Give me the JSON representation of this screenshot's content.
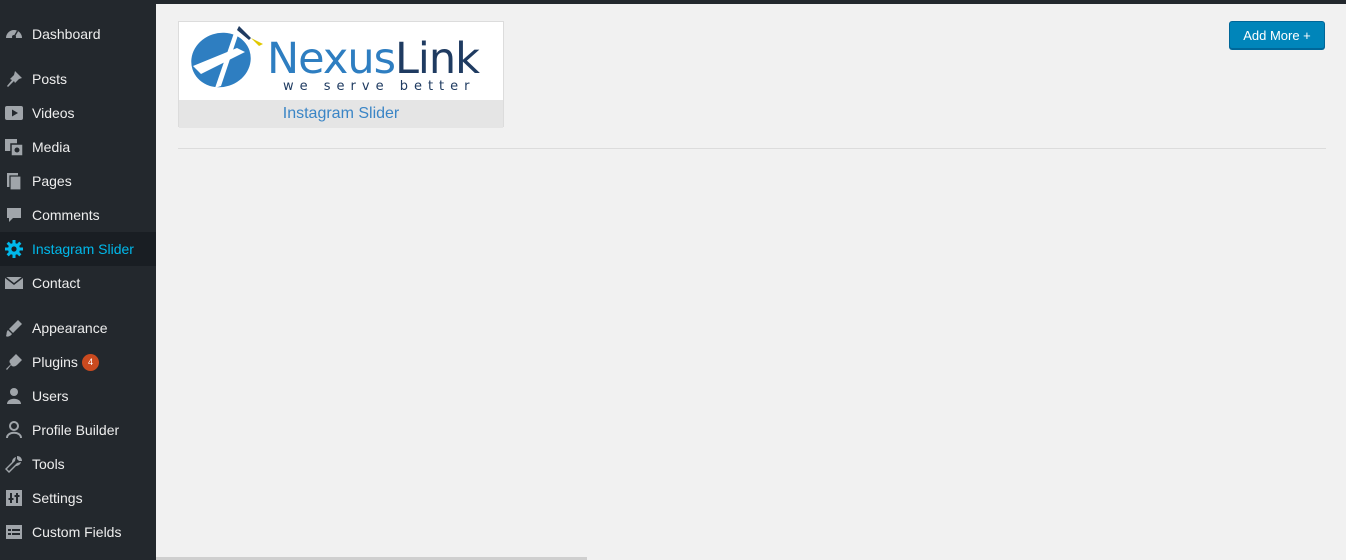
{
  "sidebar": {
    "items": [
      {
        "label": "Dashboard",
        "icon": "dashboard-icon"
      },
      {
        "label": "Posts",
        "icon": "pin-icon"
      },
      {
        "label": "Videos",
        "icon": "video-icon"
      },
      {
        "label": "Media",
        "icon": "media-icon"
      },
      {
        "label": "Pages",
        "icon": "pages-icon"
      },
      {
        "label": "Comments",
        "icon": "comment-icon"
      },
      {
        "label": "Instagram Slider",
        "icon": "gear-icon",
        "active": true
      },
      {
        "label": "Contact",
        "icon": "mail-icon"
      },
      {
        "label": "Appearance",
        "icon": "brush-icon"
      },
      {
        "label": "Plugins",
        "icon": "plugin-icon",
        "badge": "4"
      },
      {
        "label": "Users",
        "icon": "user-icon"
      },
      {
        "label": "Profile Builder",
        "icon": "profile-icon"
      },
      {
        "label": "Tools",
        "icon": "wrench-icon"
      },
      {
        "label": "Settings",
        "icon": "settings-icon"
      },
      {
        "label": "Custom Fields",
        "icon": "table-icon"
      }
    ]
  },
  "main": {
    "logo": {
      "brand_part1": "Nexus",
      "brand_part2": "Link",
      "tagline": "we serve better",
      "caption": "Instagram Slider"
    },
    "add_more_label": "Add More +"
  },
  "colors": {
    "sidebar_bg": "#23282d",
    "active_text": "#00b9eb",
    "button_bg": "#0085ba",
    "badge_bg": "#ca4a1f",
    "brand_blue": "#2e7ec1"
  }
}
